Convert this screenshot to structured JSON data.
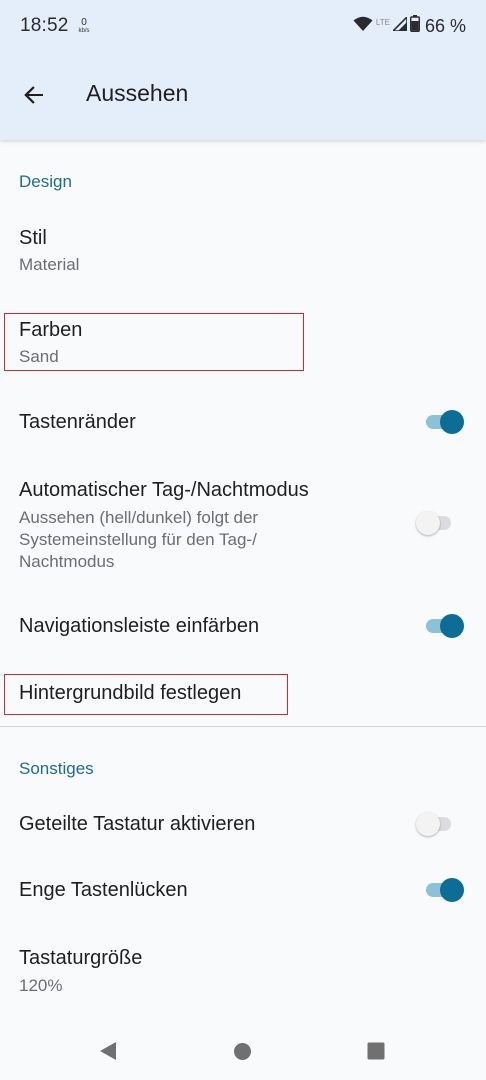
{
  "status_bar": {
    "time": "18:52",
    "net_speed_value": "0",
    "net_speed_unit": "kb/s",
    "network_type": "LTE",
    "battery_percent": "66 %",
    "icons": [
      "wifi-icon",
      "cell-signal-icon",
      "battery-icon"
    ]
  },
  "app_bar": {
    "back_icon": "arrow-back-icon",
    "title": "Aussehen"
  },
  "sections": {
    "design": {
      "header": "Design"
    },
    "other": {
      "header": "Sonstiges"
    }
  },
  "settings": {
    "style": {
      "title": "Stil",
      "value": "Material"
    },
    "colors": {
      "title": "Farben",
      "value": "Sand"
    },
    "key_borders": {
      "title": "Tastenränder",
      "enabled": true
    },
    "auto_day_night": {
      "title": "Automatischer Tag-/Nachtmodus",
      "summary": "Aussehen (hell/dunkel) folgt der Systemeinstellung für den Tag-/ Nachtmodus",
      "enabled": false
    },
    "color_nav_bar": {
      "title": "Navigationsleiste einfärben",
      "enabled": true
    },
    "background_image": {
      "title": "Hintergrundbild festlegen"
    },
    "split_keyboard": {
      "title": "Geteilte Tastatur aktivieren",
      "enabled": false
    },
    "narrow_key_gaps": {
      "title": "Enge Tastenlücken",
      "enabled": true
    },
    "keyboard_size": {
      "title": "Tastaturgröße",
      "value": "120%"
    }
  },
  "nav_bar": {
    "icons": [
      "nav-back-icon",
      "nav-home-icon",
      "nav-recents-icon"
    ]
  },
  "colors": {
    "accent": "#0d6d95",
    "section_header": "#1f6b8c",
    "app_bar_bg": "#e4eefb",
    "highlight_box": "#cc2b2b"
  }
}
